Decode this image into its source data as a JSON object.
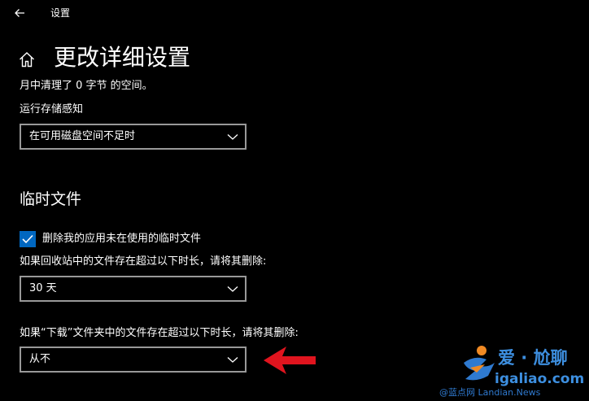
{
  "window": {
    "title": "设置",
    "back_icon": "arrow-left-icon"
  },
  "header": {
    "home_icon": "home-icon",
    "title": "更改详细设置"
  },
  "storage_sense": {
    "freed_text": "月中清理了 0 字节 的空间。",
    "run_label": "运行存储感知",
    "run_value": "在可用磁盘空间不足时"
  },
  "temp_files": {
    "section_title": "临时文件",
    "delete_temp_checkbox": {
      "label": "删除我的应用未在使用的临时文件",
      "checked": true
    },
    "recycle_bin_label": "如果回收站中的文件存在超过以下时长，请将其删除:",
    "recycle_bin_value": "30 天",
    "downloads_label": "如果“下载”文件夹中的文件存在超过以下时长，请将其删除:",
    "downloads_value": "从不"
  },
  "annotation": {
    "arrow_color": "#e0141e"
  },
  "watermark": {
    "line1": "爱 · 尬聊",
    "line2": "igaliao.com",
    "line3": "@蓝点网 Landian.News"
  },
  "colors": {
    "background": "#000000",
    "text": "#ffffff",
    "dropdown_border": "#999999",
    "checkbox_fill": "#0067c0"
  }
}
